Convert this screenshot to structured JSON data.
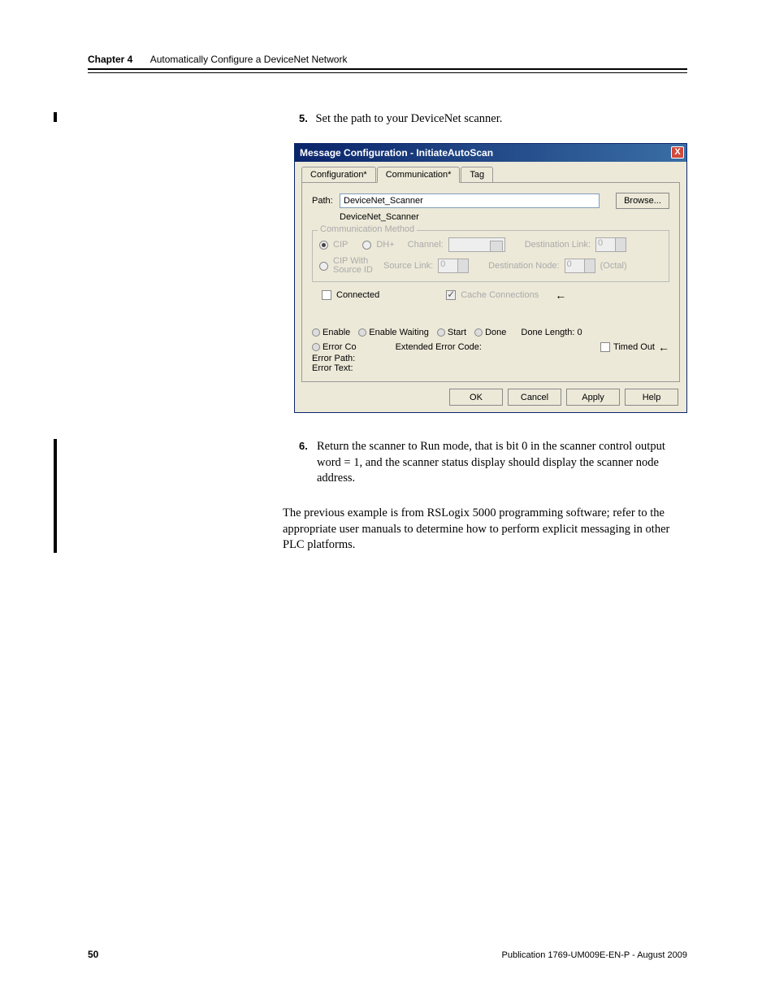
{
  "header": {
    "chapter_label": "Chapter 4",
    "chapter_title": "Automatically Configure a DeviceNet Network"
  },
  "step5": {
    "number": "5.",
    "text": "Set the path to your DeviceNet scanner."
  },
  "dialog": {
    "title": "Message Configuration - InitiateAutoScan",
    "close": "X",
    "tabs": {
      "config": "Configuration*",
      "comm": "Communication*",
      "tag": "Tag"
    },
    "path_label": "Path:",
    "path_value": "DeviceNet_Scanner",
    "path_display": "DeviceNet_Scanner",
    "browse": "Browse...",
    "fieldset_label": "Communication Method",
    "cip": "CIP",
    "dhplus": "DH+",
    "channel": "Channel:",
    "dest_link": "Destination Link:",
    "cip_with": "CIP With Source ID",
    "source_link": "Source Link:",
    "dest_node": "Destination Node:",
    "octal": "(Octal)",
    "link_val": "0",
    "connected": "Connected",
    "cache_conn": "Cache Connections",
    "enable": "Enable",
    "enable_waiting": "Enable Waiting",
    "start": "Start",
    "done": "Done",
    "done_length": "Done Length: 0",
    "error_co": "Error Co",
    "ext_err": "Extended Error Code:",
    "timed_out": "Timed Out",
    "error_path": "Error Path:",
    "error_text": "Error Text:",
    "ok": "OK",
    "cancel": "Cancel",
    "apply": "Apply",
    "help": "Help"
  },
  "step6": {
    "number": "6.",
    "text": "Return the scanner to Run mode, that is bit 0 in the scanner control output word = 1, and the scanner status display should display the scanner node address."
  },
  "paragraph": "The previous example is from RSLogix 5000 programming software; refer to the appropriate user manuals to determine how to perform explicit messaging in other PLC platforms.",
  "footer": {
    "page": "50",
    "pub": "Publication 1769-UM009E-EN-P - August 2009"
  }
}
